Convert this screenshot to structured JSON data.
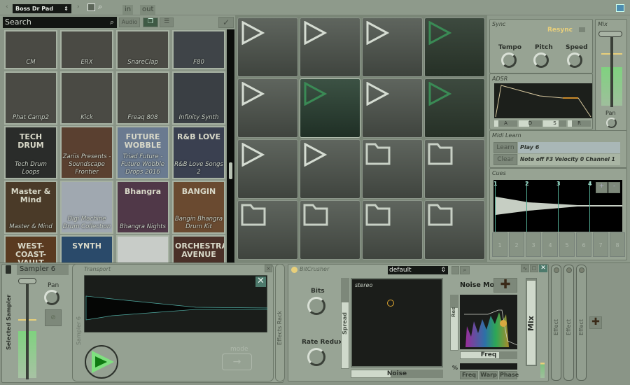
{
  "topbar": {
    "preset": "Boss Dr Pad",
    "in": "in",
    "out": "out"
  },
  "browser": {
    "search_placeholder": "Search",
    "audio_tab": "Audio",
    "tiles": [
      "CM",
      "ERX",
      "SnareClap",
      "F80",
      "Phat Camp2",
      "Kick",
      "Freaq 808",
      "Infinity Synth",
      "Tech Drum Loops",
      "Zariis Presents - Soundscape Frontier",
      "Triad Future - Future Wobble Drops 2016",
      "R&B Love Songs 2",
      "Master & Mind",
      "Digi Machine Drum Collection",
      "Bhangra Nights",
      "Bangin Bhangra Drum Kit",
      "",
      "",
      "",
      ""
    ],
    "tile_art": [
      "",
      "",
      "",
      "",
      "",
      "",
      "",
      "",
      "TECH DRUM",
      "",
      "FUTURE WOBBLE",
      "R&B LOVE",
      "Master & Mind",
      "",
      "Bhangra",
      "BANGIN",
      "WEST-COAST-VAULT",
      "SYNTH",
      "",
      "ORCHESTRA AVENUE"
    ]
  },
  "pads": [
    "play",
    "play",
    "play",
    "play-dark",
    "play",
    "play-active",
    "play",
    "play-dark",
    "play",
    "play",
    "folder",
    "folder",
    "folder",
    "folder",
    "folder",
    "folder"
  ],
  "sync": {
    "title": "Sync",
    "resync": "Resync",
    "knobs": [
      "Tempo",
      "Pitch",
      "Speed"
    ]
  },
  "mix": {
    "title": "Mix",
    "pan": "Pan",
    "level": 0.55
  },
  "adsr": {
    "title": "ADSR",
    "params": [
      "A",
      "D",
      "S",
      "R"
    ]
  },
  "midi": {
    "title": "Midi Learn",
    "learn": "Learn",
    "clear": "Clear",
    "line1": "Play 6",
    "line2": "Note off F3 Velocity 0 Channel 1"
  },
  "cues": {
    "title": "Cues",
    "markers": [
      "1",
      "2",
      "3",
      "4"
    ],
    "plus": "+",
    "minus": "-",
    "buttons": [
      "1",
      "2",
      "3",
      "4",
      "5",
      "6",
      "7",
      "8"
    ]
  },
  "sampler": {
    "name": "Sampler 6",
    "vertical_label": "Selected Sampler",
    "pan": "Pan",
    "transport": "Transport",
    "side_label": "Sampler 6",
    "mode": "mode",
    "effects_rack": "Effects Rack"
  },
  "bitcrusher": {
    "title": "BitCrusher",
    "preset": "default",
    "bits": "Bits",
    "rate": "Rate Redux",
    "spread": "Spread",
    "stereo": "stereo",
    "noise": "Noise",
    "noise_mod": "Noise Mod",
    "res": "Res",
    "freq": "Freq",
    "percent": "%",
    "mod_tabs": [
      "Freq",
      "Warp",
      "Phase"
    ],
    "mix": "Mix"
  },
  "effects": [
    "Effect",
    "Effect",
    "Effect"
  ],
  "colors": {
    "accent": "#e8cf7a",
    "green": "#7fe07f",
    "bg": "#8e9a8b"
  }
}
